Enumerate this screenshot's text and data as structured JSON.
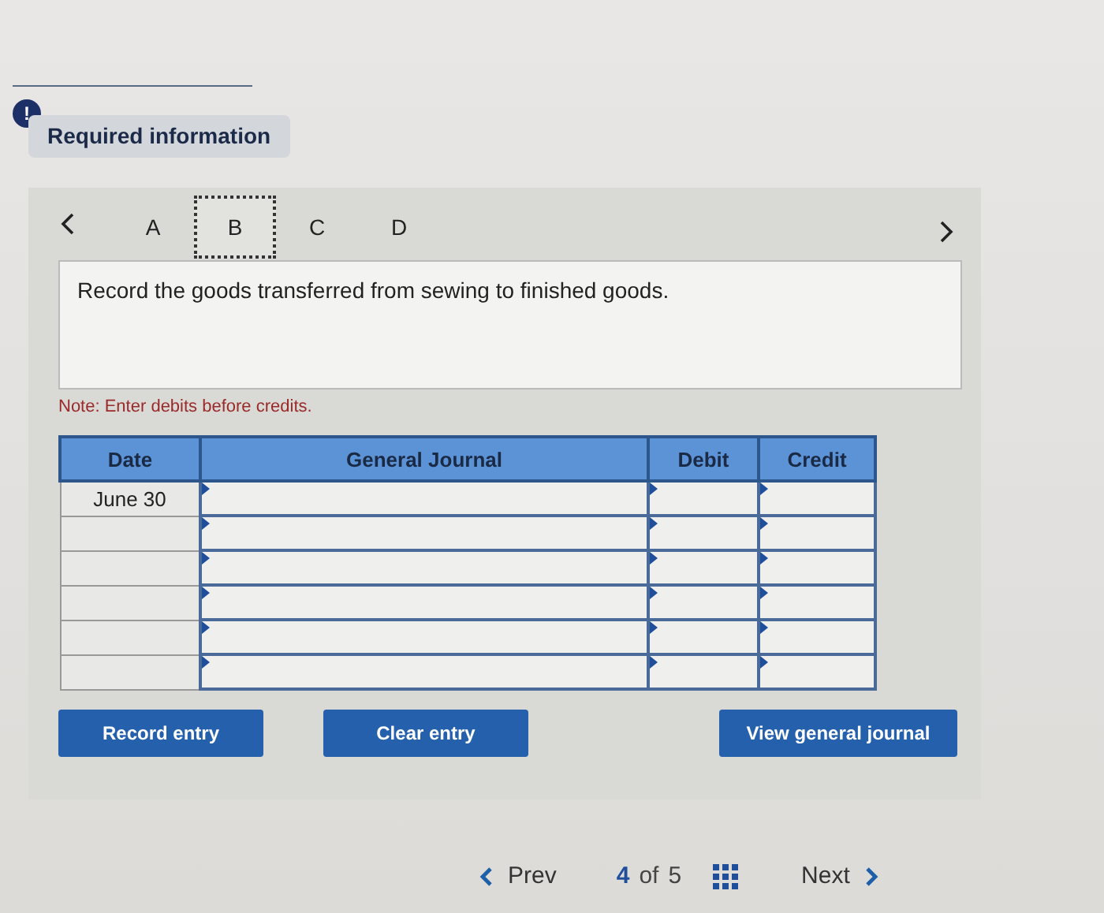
{
  "badge": {
    "symbol": "!"
  },
  "section_title": "Required information",
  "tabs": [
    {
      "label": "A",
      "selected": false
    },
    {
      "label": "B",
      "selected": true
    },
    {
      "label": "C",
      "selected": false
    },
    {
      "label": "D",
      "selected": false
    }
  ],
  "question": "Record the goods transferred from sewing to finished goods.",
  "note": "Note: Enter debits before credits.",
  "table": {
    "columns": [
      "Date",
      "General Journal",
      "Debit",
      "Credit"
    ],
    "rows": [
      {
        "date": "June 30"
      },
      {},
      {},
      {},
      {},
      {}
    ]
  },
  "buttons": [
    "Record entry",
    "Clear entry",
    "View general journal"
  ],
  "pager": {
    "prev": "Prev",
    "current": "4",
    "of": "of",
    "total": "5",
    "next": "Next"
  }
}
